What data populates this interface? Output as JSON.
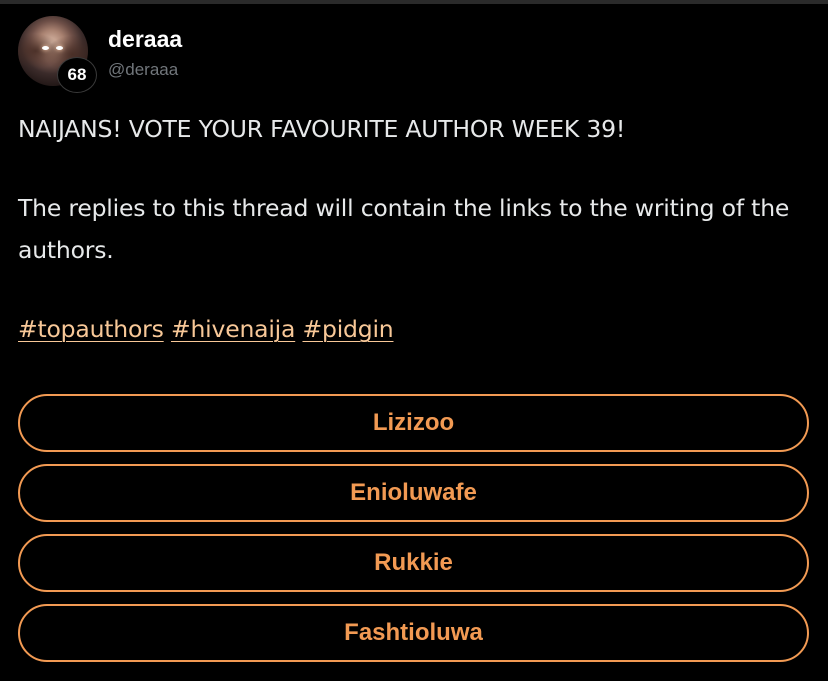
{
  "author": {
    "display_name": "deraaa",
    "handle": "@deraaa",
    "reputation": "68",
    "avatar_icon": "avatar-portrait"
  },
  "post": {
    "headline": "NAIJANS! VOTE YOUR FAVOURITE AUTHOR WEEK 39!",
    "description": "The replies to this thread will contain the links to the writing of the authors.",
    "tags": [
      "#topauthors",
      "#hivenaija",
      "#pidgin"
    ]
  },
  "poll": {
    "options": [
      "Lizizoo",
      "Enioluwafe",
      "Rukkie",
      "Fashtioluwa"
    ]
  },
  "colors": {
    "background": "#000000",
    "text": "#e7e9ea",
    "muted": "#71767b",
    "tag": "#f8c898",
    "accent": "#f29a53"
  }
}
